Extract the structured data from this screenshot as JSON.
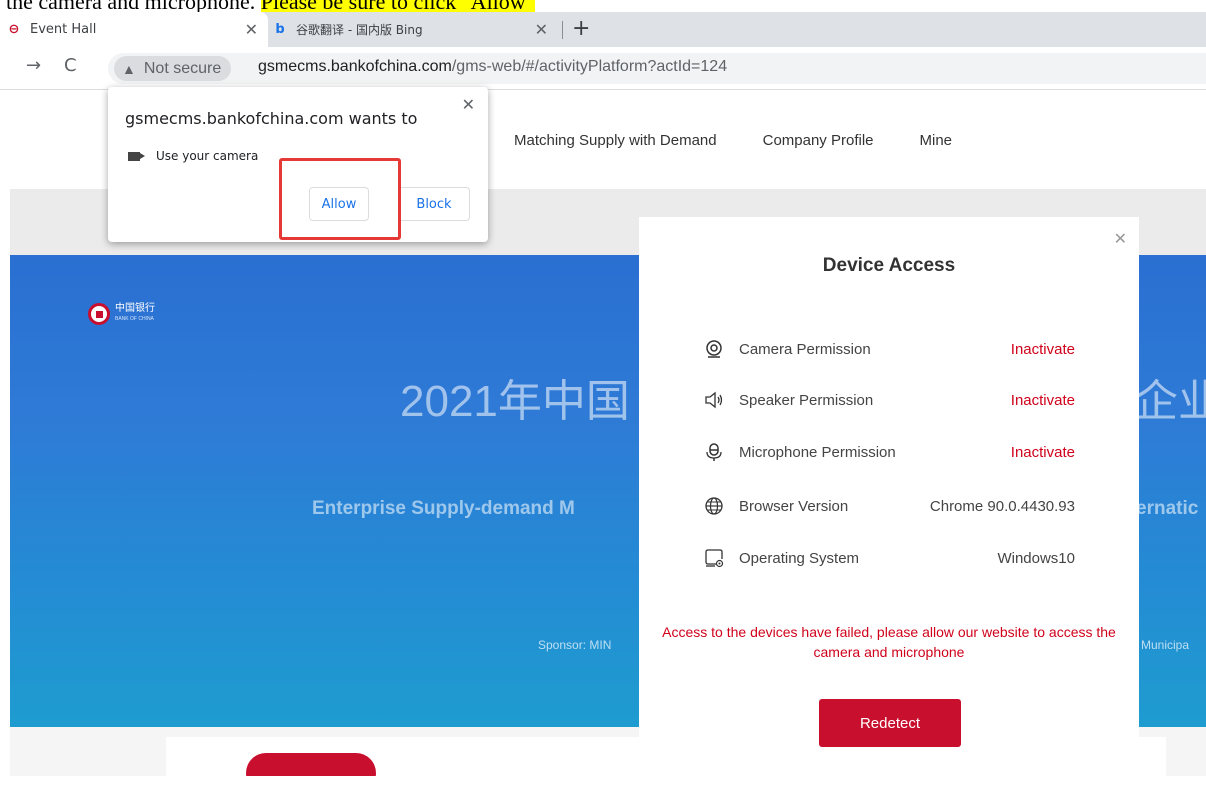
{
  "doc": {
    "prefix": "the camera and microphone. ",
    "highlight": "Please be sure to click \"Allow\""
  },
  "browser": {
    "tabs": [
      {
        "title": "Event Hall",
        "favicon": "bank-of-china-icon"
      },
      {
        "title": "谷歌翻译 - 国内版 Bing",
        "favicon": "bing-icon"
      }
    ],
    "security_label": "Not secure",
    "url_host": "gsmecms.bankofchina.com",
    "url_path": "/gms-web/#/activityPlatform?actId=124"
  },
  "site": {
    "nav": [
      "Matching Supply with Demand",
      "Company Profile",
      "Mine"
    ],
    "logo_text": "中国银行",
    "logo_sub": "BANK OF CHINA",
    "banner_title_left": "2021年中国",
    "banner_title_right": "企业",
    "banner_sub_left": "Enterprise Supply-demand M",
    "banner_sub_right": "ernatic",
    "sponsor_left": "Sponsor: MIN",
    "sponsor_right": "Municipa"
  },
  "permission_popup": {
    "title": "gsmecms.bankofchina.com wants to",
    "request": "Use your camera",
    "allow": "Allow",
    "block": "Block"
  },
  "device_access": {
    "title": "Device Access",
    "rows": [
      {
        "icon": "camera-icon",
        "label": "Camera Permission",
        "value": "Inactivate",
        "status": "error"
      },
      {
        "icon": "speaker-icon",
        "label": "Speaker Permission",
        "value": "Inactivate",
        "status": "error"
      },
      {
        "icon": "microphone-icon",
        "label": "Microphone Permission",
        "value": "Inactivate",
        "status": "error"
      },
      {
        "icon": "globe-icon",
        "label": "Browser Version",
        "value": "Chrome 90.0.4430.93",
        "status": "ok"
      },
      {
        "icon": "monitor-icon",
        "label": "Operating System",
        "value": "Windows10",
        "status": "ok"
      }
    ],
    "error_message": "Access to the devices have failed, please allow our website to access the camera and microphone",
    "redetect": "Redetect"
  },
  "colors": {
    "brand_red": "#c8102e",
    "error_red": "#d0021b",
    "chrome_blue": "#1a73e8"
  }
}
